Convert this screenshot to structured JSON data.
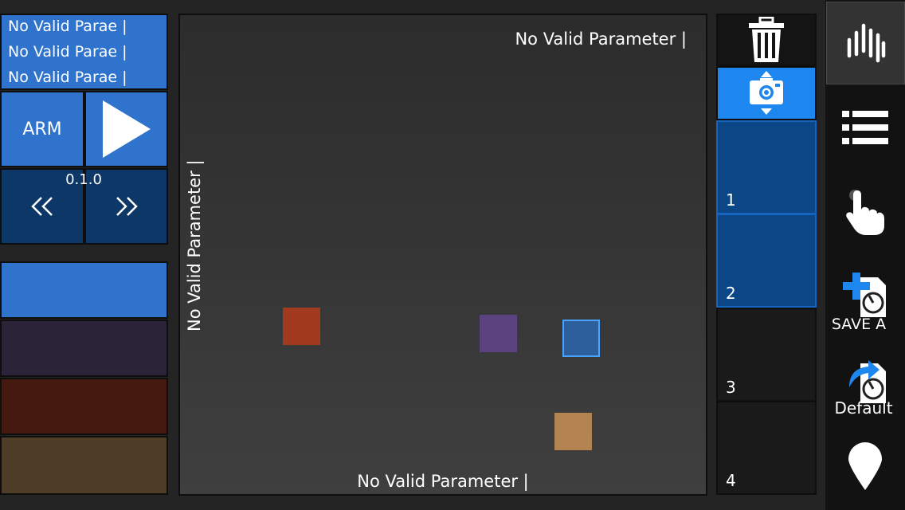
{
  "params": [
    "No Valid Parae  |",
    "No Valid Parae  |",
    "No Valid Parae  |"
  ],
  "transport": {
    "arm_label": "ARM",
    "version": "0.1.0"
  },
  "pad": {
    "top_label": "No Valid Parameter |",
    "bottom_label": "No Valid Parameter |",
    "left_label": "No Valid Parameter |"
  },
  "snapshots": [
    "1",
    "2",
    "3",
    "4"
  ],
  "sidebar": {
    "save_label": "SAVE A",
    "default_label": "Default"
  },
  "colors": {
    "accent": "#2f73cc",
    "camera": "#1e87ef",
    "active_snapshot": "#0b4786",
    "node_red": "#a23a1f",
    "node_purple": "#5b4380",
    "node_blue": "#2d5f9c",
    "node_tan": "#b38452"
  }
}
